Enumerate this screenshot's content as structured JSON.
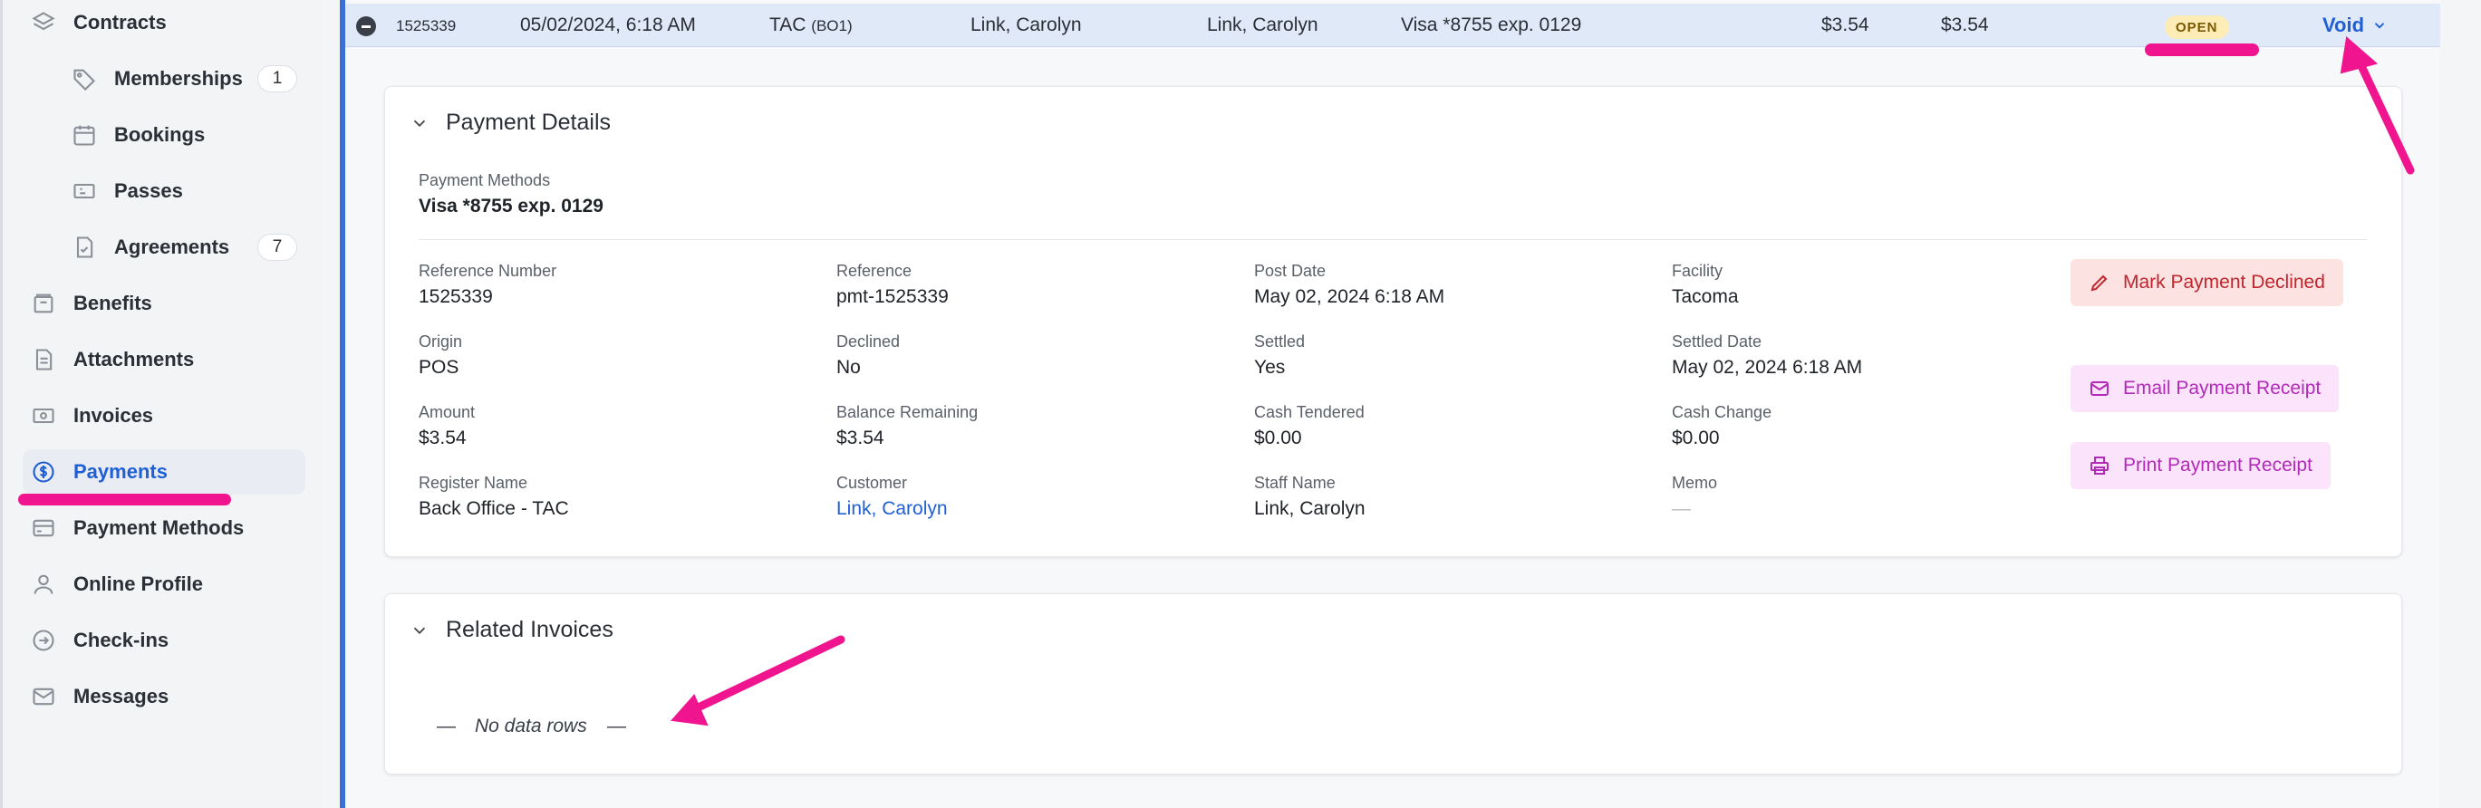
{
  "sidebar": {
    "items": [
      {
        "label": "Contracts"
      },
      {
        "label": "Memberships",
        "count": "1"
      },
      {
        "label": "Bookings"
      },
      {
        "label": "Passes"
      },
      {
        "label": "Agreements",
        "count": "7"
      },
      {
        "label": "Benefits"
      },
      {
        "label": "Attachments"
      },
      {
        "label": "Invoices"
      },
      {
        "label": "Payments"
      },
      {
        "label": "Payment Methods"
      },
      {
        "label": "Online Profile"
      },
      {
        "label": "Check-ins"
      },
      {
        "label": "Messages"
      }
    ]
  },
  "row": {
    "id": "1525339",
    "datetime": "05/02/2024, 6:18 AM",
    "location": "TAC",
    "location_code": "(BO1)",
    "staff": "Link, Carolyn",
    "customer": "Link, Carolyn",
    "method": "Visa *8755 exp. 0129",
    "amount": "$3.54",
    "balance": "$3.54",
    "status": "OPEN",
    "action": "Void"
  },
  "details": {
    "title": "Payment Details",
    "methods_label": "Payment Methods",
    "methods_value": "Visa *8755 exp. 0129",
    "fields": {
      "reference_number": {
        "label": "Reference Number",
        "value": "1525339"
      },
      "reference": {
        "label": "Reference",
        "value": "pmt-1525339"
      },
      "post_date": {
        "label": "Post Date",
        "value": "May 02, 2024 6:18 AM"
      },
      "facility": {
        "label": "Facility",
        "value": "Tacoma"
      },
      "origin": {
        "label": "Origin",
        "value": "POS"
      },
      "declined": {
        "label": "Declined",
        "value": "No"
      },
      "settled": {
        "label": "Settled",
        "value": "Yes"
      },
      "settled_date": {
        "label": "Settled Date",
        "value": "May 02, 2024 6:18 AM"
      },
      "amount": {
        "label": "Amount",
        "value": "$3.54"
      },
      "balance_remaining": {
        "label": "Balance Remaining",
        "value": "$3.54"
      },
      "cash_tendered": {
        "label": "Cash Tendered",
        "value": "$0.00"
      },
      "cash_change": {
        "label": "Cash Change",
        "value": "$0.00"
      },
      "register_name": {
        "label": "Register Name",
        "value": "Back Office - TAC"
      },
      "customer": {
        "label": "Customer",
        "value": "Link, Carolyn"
      },
      "staff_name": {
        "label": "Staff Name",
        "value": "Link, Carolyn"
      },
      "memo": {
        "label": "Memo",
        "value": "—"
      }
    },
    "actions": {
      "decline": "Mark Payment Declined",
      "email": "Email Payment Receipt",
      "print": "Print Payment Receipt"
    }
  },
  "invoices": {
    "title": "Related Invoices",
    "empty_dash_left": "—",
    "empty": "No data rows",
    "empty_dash_right": "—"
  },
  "colors": {
    "accent": "#1f5fd6",
    "annotation": "#f0158f",
    "badge_open_bg": "#fdecb5"
  }
}
